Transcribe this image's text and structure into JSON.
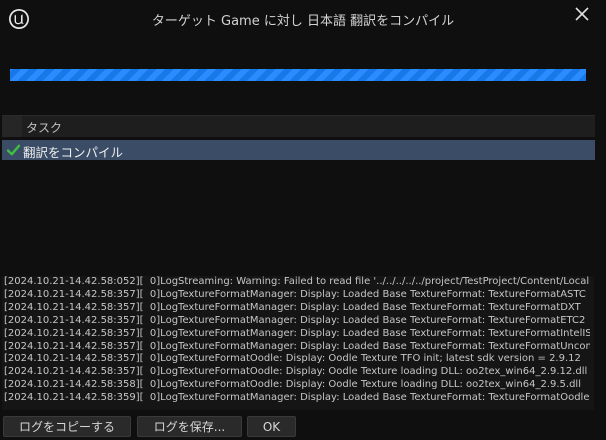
{
  "window": {
    "title": "ターゲット Game に対し 日本語 翻訳をコンパイル"
  },
  "icons": {
    "logo": "unreal-engine-logo-icon",
    "close": "close-icon",
    "task_status": "checkmark-icon"
  },
  "colors": {
    "progress": "#1878e8",
    "selected_row": "#3b4d66",
    "check": "#3fbf3f"
  },
  "progress": {
    "fraction": 1.0
  },
  "tasks": {
    "header": "タスク",
    "items": [
      {
        "label": "翻訳をコンパイル",
        "status": "done"
      }
    ]
  },
  "log": {
    "lines": [
      "[2024.10.21-14.42.58:052][  0]LogStreaming: Warning: Failed to read file '../../../../../project/TestProject/Content/Local",
      "[2024.10.21-14.42.58:357][  0]LogTextureFormatManager: Display: Loaded Base TextureFormat: TextureFormatASTC",
      "[2024.10.21-14.42.58:357][  0]LogTextureFormatManager: Display: Loaded Base TextureFormat: TextureFormatDXT",
      "[2024.10.21-14.42.58:357][  0]LogTextureFormatManager: Display: Loaded Base TextureFormat: TextureFormatETC2",
      "[2024.10.21-14.42.58:357][  0]LogTextureFormatManager: Display: Loaded Base TextureFormat: TextureFormatIntelISP",
      "[2024.10.21-14.42.58:357][  0]LogTextureFormatManager: Display: Loaded Base TextureFormat: TextureFormatUncom",
      "[2024.10.21-14.42.58:357][  0]LogTextureFormatOodle: Display: Oodle Texture TFO init; latest sdk version = 2.9.12",
      "[2024.10.21-14.42.58:357][  0]LogTextureFormatOodle: Display: Oodle Texture loading DLL: oo2tex_win64_2.9.12.dll",
      "[2024.10.21-14.42.58:358][  0]LogTextureFormatOodle: Display: Oodle Texture loading DLL: oo2tex_win64_2.9.5.dll",
      "[2024.10.21-14.42.58:359][  0]LogTextureFormatManager: Display: Loaded Base TextureFormat: TextureFormatOodle"
    ]
  },
  "buttons": {
    "copy_log": "ログをコピーする",
    "save_log": "ログを保存...",
    "ok": "OK"
  }
}
